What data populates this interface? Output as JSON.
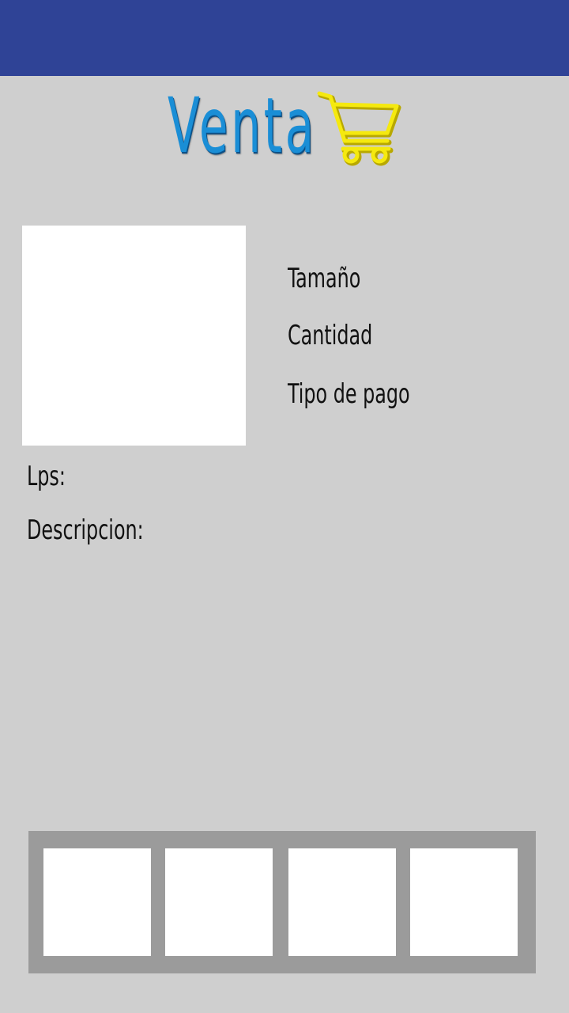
{
  "header": {
    "title": "Venta",
    "logo_icon": "shopping-cart-icon",
    "bar_color": "#2f4396"
  },
  "product": {
    "image": "product-image-placeholder",
    "labels": {
      "tamano": "Tamaño",
      "cantidad": "Cantidad",
      "tipo_pago": "Tipo de pago",
      "lps": "Lps:",
      "descripcion": "Descripcion:"
    }
  },
  "thumbnails": [
    "thumbnail-1",
    "thumbnail-2",
    "thumbnail-3",
    "thumbnail-4"
  ],
  "colors": {
    "background": "#cfcfcf",
    "title": "#1a8ed6",
    "cart": "#f5e90f",
    "strip": "#9b9b9b"
  }
}
